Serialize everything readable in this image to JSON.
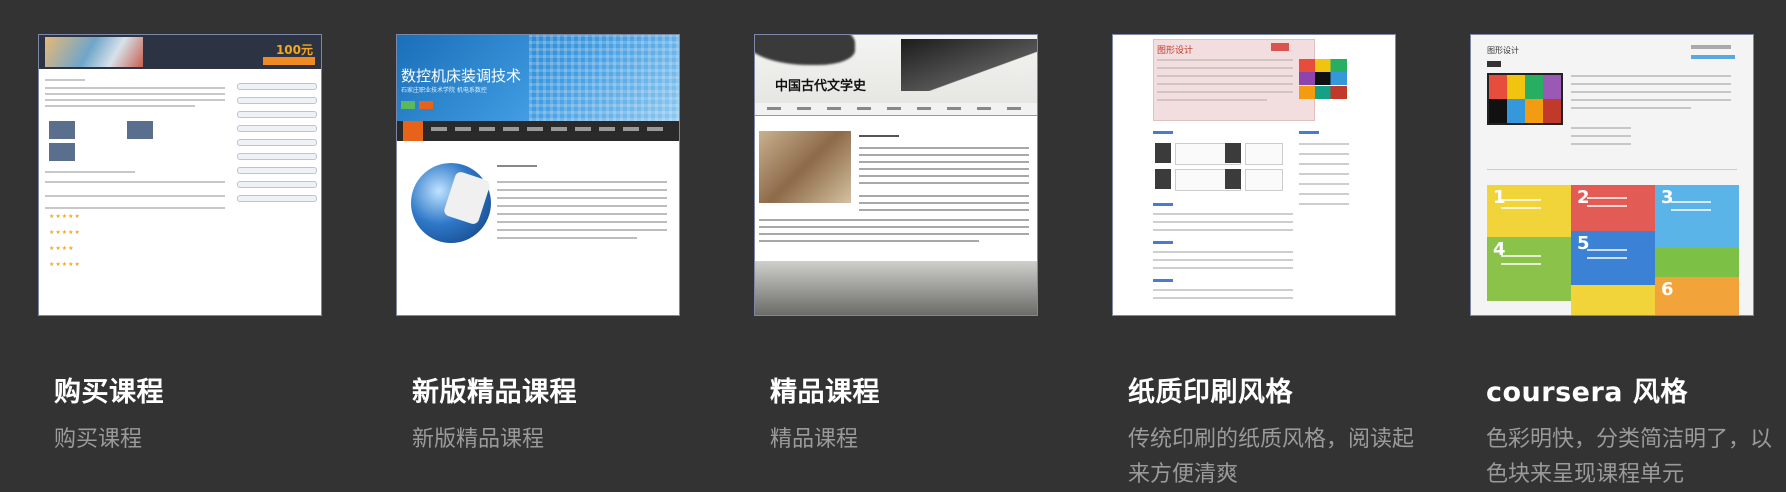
{
  "cards": [
    {
      "title": "购买课程",
      "description": "购买课程",
      "thumb": {
        "price": "100元"
      }
    },
    {
      "title": "新版精品课程",
      "description": "新版精品课程",
      "thumb": {
        "hero_title": "数控机床装调技术",
        "hero_sub": "石家庄职业技术学院 机电系数控"
      }
    },
    {
      "title": "精品课程",
      "description": "精品课程",
      "thumb": {
        "hero_title": "中国古代文学史"
      }
    },
    {
      "title": "纸质印刷风格",
      "description": "传统印刷的纸质风格，阅读起来方便清爽",
      "thumb": {
        "heading": "图形设计"
      }
    },
    {
      "title": "coursera 风格",
      "description": "色彩明快，分类简洁明了，以色块来呈现课程单元",
      "thumb": {
        "heading": "图形设计",
        "blocks": [
          "1",
          "2",
          "3",
          "4",
          "5",
          "6"
        ]
      }
    }
  ],
  "colors": {
    "background": "#333333",
    "title": "#ffffff",
    "description": "#9a9a9a",
    "accent_orange": "#f08a24"
  }
}
